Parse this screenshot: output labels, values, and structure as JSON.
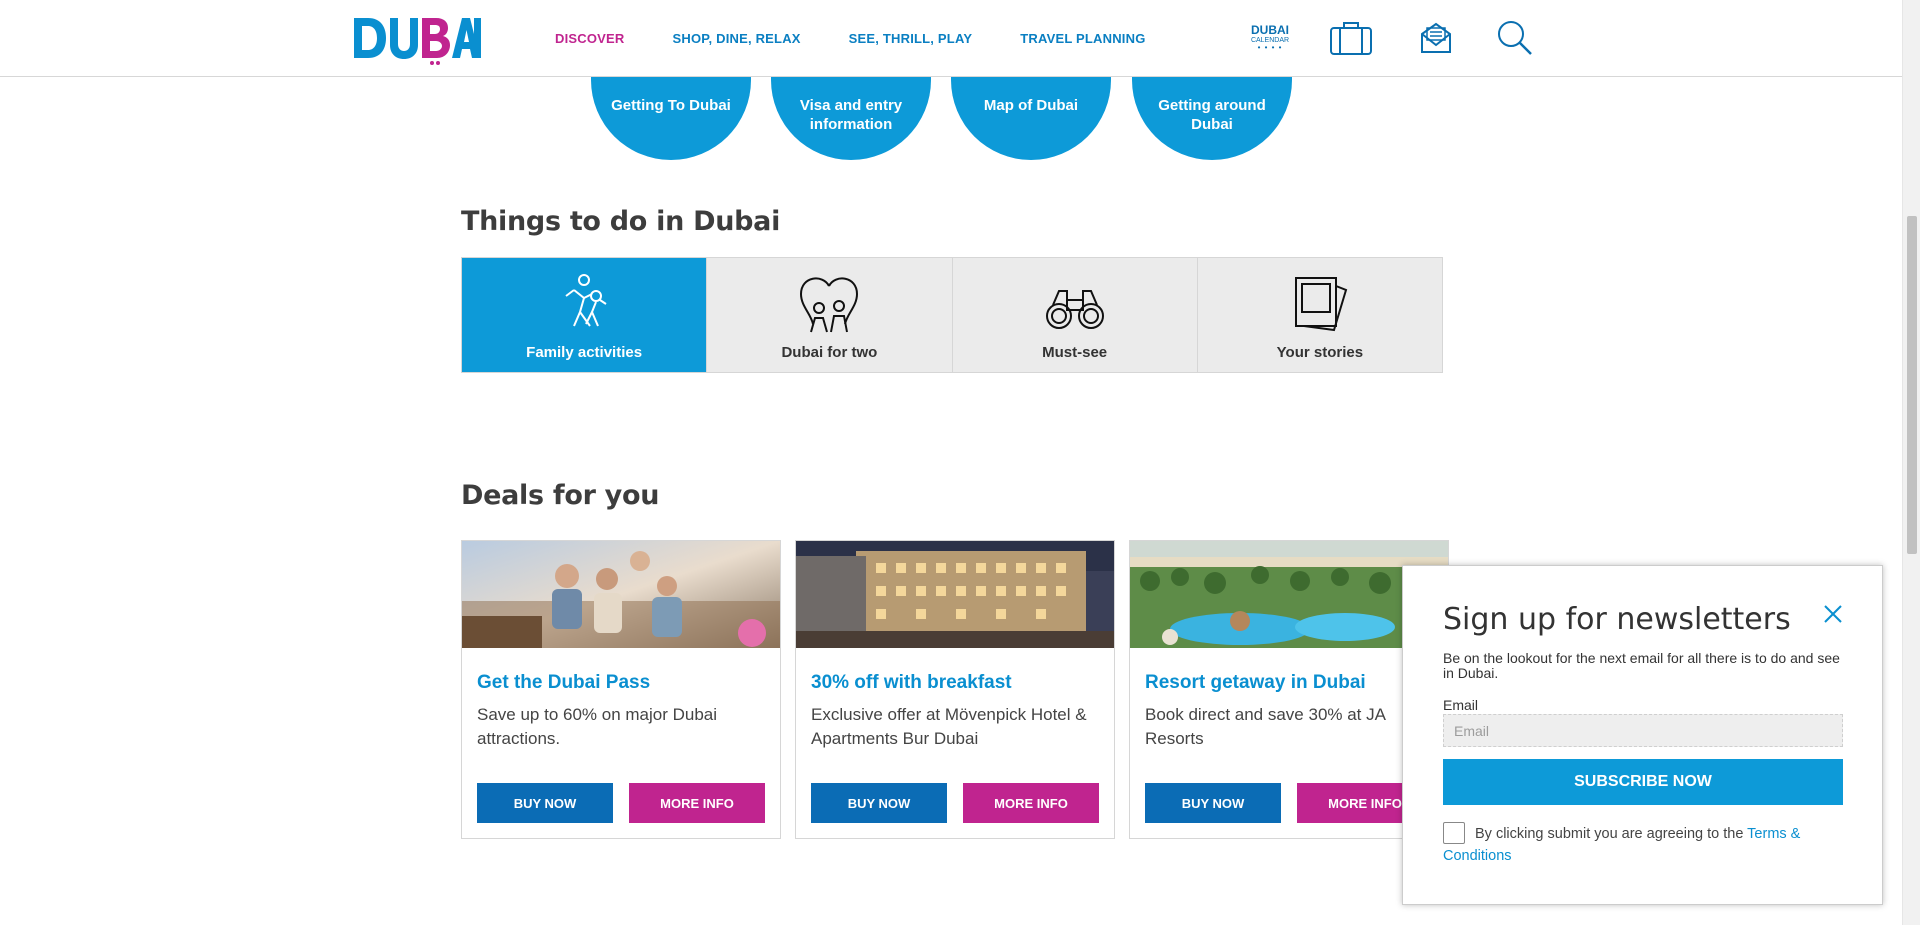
{
  "header": {
    "logo_text": "DUBAI",
    "nav": [
      {
        "label": "DISCOVER",
        "active": true
      },
      {
        "label": "SHOP, DINE, RELAX",
        "active": false
      },
      {
        "label": "SEE, THRILL, PLAY",
        "active": false
      },
      {
        "label": "TRAVEL PLANNING",
        "active": false
      }
    ],
    "calendar_line1": "DUBAI",
    "calendar_line2": "CALENDAR",
    "calendar_dots": "• • • •",
    "icons": [
      "suitcase-icon",
      "mail-icon",
      "search-icon"
    ]
  },
  "planning": {
    "items": [
      {
        "label": "Getting To Dubai",
        "icon": "plane-icon"
      },
      {
        "label": "Visa and entry information",
        "icon": "passport-icon"
      },
      {
        "label": "Map of Dubai",
        "icon": "map-icon"
      },
      {
        "label": "Getting around Dubai",
        "icon": "car-icon"
      }
    ]
  },
  "things_to_do": {
    "title": "Things to do in Dubai",
    "tabs": [
      {
        "label": "Family activities",
        "icon": "family-icon",
        "active": true
      },
      {
        "label": "Dubai for two",
        "icon": "couple-heart-icon",
        "active": false
      },
      {
        "label": "Must-see",
        "icon": "binoculars-icon",
        "active": false
      },
      {
        "label": "Your stories",
        "icon": "photos-icon",
        "active": false
      }
    ]
  },
  "deals": {
    "title": "Deals for you",
    "items": [
      {
        "title": "Get the Dubai Pass",
        "desc": "Save up to 60% on major Dubai attractions.",
        "buy": "BUY NOW",
        "more": "MORE INFO"
      },
      {
        "title": "30% off with breakfast",
        "desc": "Exclusive offer at Mövenpick Hotel & Apartments Bur Dubai",
        "buy": "BUY NOW",
        "more": "MORE INFO"
      },
      {
        "title": "Resort getaway in Dubai",
        "desc": "Book direct and save 30% at JA Resorts",
        "buy": "BUY NOW",
        "more": "MORE INFO"
      }
    ]
  },
  "newsletter": {
    "title": "Sign up for newsletters",
    "desc": "Be on the lookout for the next email for all there is to do and see in Dubai.",
    "email_label": "Email",
    "email_placeholder": "Email",
    "email_value": "",
    "submit_label": "SUBSCRIBE NOW",
    "terms_text": "By clicking submit you are agreeing to the ",
    "terms_link_1": "Terms &",
    "terms_link_2": "Conditions"
  },
  "colors": {
    "brand_blue": "#0d9ad8",
    "button_blue": "#0b6cb5",
    "magenta": "#c0248f",
    "link_blue": "#0a8fd0"
  }
}
